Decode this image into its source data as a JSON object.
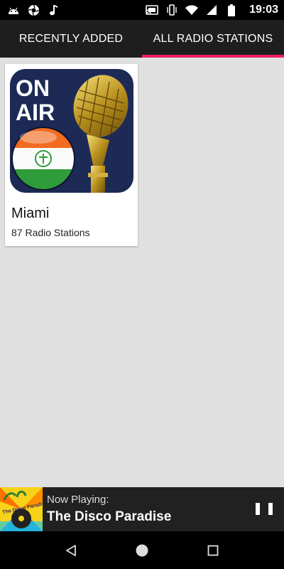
{
  "status_bar": {
    "time": "19:03",
    "left_icons": [
      "android-icon",
      "aperture-icon",
      "music-note-icon"
    ],
    "right_icons": [
      "cast-icon",
      "vibrate-icon",
      "wifi-icon",
      "signal-icon",
      "battery-icon"
    ]
  },
  "tabs": [
    {
      "label": "RECENTLY ADDED",
      "active": false
    },
    {
      "label": "ALL RADIO STATIONS",
      "active": true
    }
  ],
  "stations": [
    {
      "title": "Miami",
      "subtitle": "87 Radio Stations",
      "art_text": [
        "ON",
        "AIR"
      ]
    }
  ],
  "now_playing": {
    "label": "Now Playing:",
    "title": "The Disco Paradise",
    "thumb_text": "The Disco Paradise"
  },
  "colors": {
    "accent": "#e91e63",
    "tab_bar": "#1e1e1e",
    "background": "#e0e0e0",
    "art_background": "#1d2a55"
  }
}
